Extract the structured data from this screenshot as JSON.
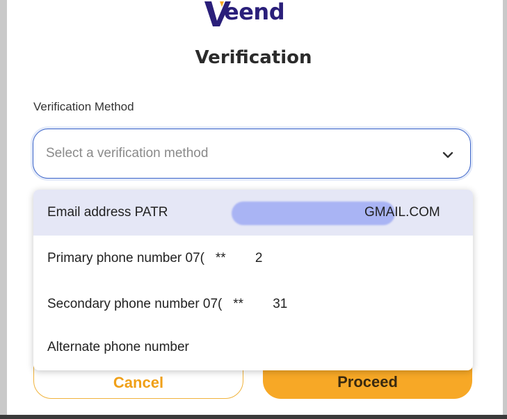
{
  "brand": {
    "logo_text": "eend"
  },
  "page": {
    "title": "Verification"
  },
  "form": {
    "method_label": "Verification Method",
    "select_placeholder": "Select a verification method"
  },
  "dropdown": {
    "options": [
      {
        "label": "Email address PATR",
        "suffix": "GMAIL.COM",
        "selected": true
      },
      {
        "label": "Primary phone number 07(   **        2"
      },
      {
        "label": "Secondary phone number 07(   **        31"
      },
      {
        "label": "Alternate phone number"
      }
    ]
  },
  "actions": {
    "cancel_label": "Cancel",
    "proceed_label": "Proceed"
  },
  "colors": {
    "accent": "#f7a826",
    "brand": "#2a1f7a",
    "focus": "#3a63c9",
    "highlight": "#e5e7f6"
  }
}
